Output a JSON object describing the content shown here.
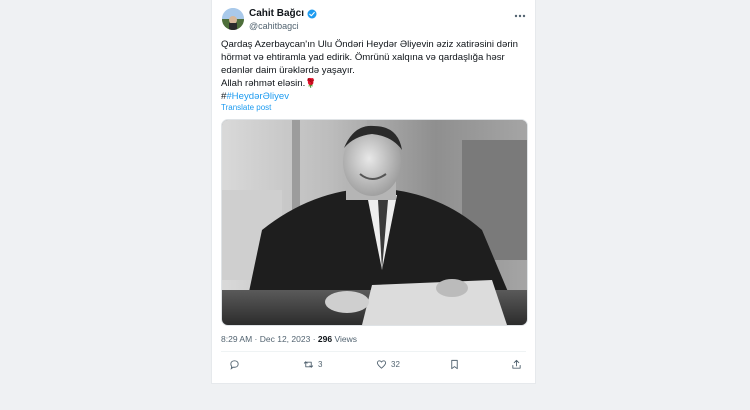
{
  "author": {
    "name": "Cahit Bağcı",
    "handle": "@cahitbagci"
  },
  "tweet": {
    "line1": "Qardaş Azerbaycan'ın Ulu Öndəri Heydər Əliyevin əziz xatirəsini dərin",
    "line2": "hörmət və ehtiramla yad edirik. Ömrünü xalqına və qardaşlığa həsr",
    "line3": "edənlər daim ürəklərdə yaşayır.",
    "line4": "Allah rəhmət eləsin.",
    "hashtag_prefix": "#",
    "hashtag": "#HeydərƏliyev",
    "translate": "Translate post"
  },
  "meta": {
    "time": "8:29 AM",
    "separator1": " · ",
    "date": "Dec 12, 2023",
    "separator2": " · ",
    "views_count": "296",
    "views_label": " Views"
  },
  "actions": {
    "reply_count": "",
    "retweet_count": "3",
    "like_count": "32"
  },
  "colors": {
    "accent": "#1d9bf0",
    "text": "#0f1419",
    "muted": "#536471"
  },
  "icons": [
    "verified-badge-icon",
    "more-icon",
    "reply-icon",
    "retweet-icon",
    "like-icon",
    "bookmark-icon",
    "share-icon",
    "rose-emoji-icon"
  ]
}
